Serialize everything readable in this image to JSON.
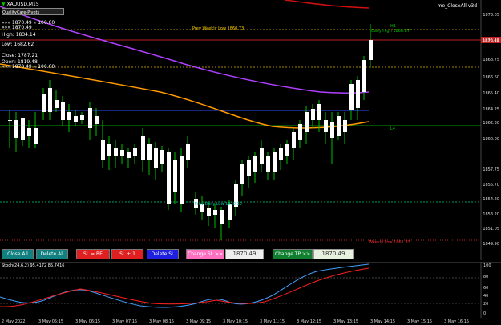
{
  "chart": {
    "symbol_line": "XAUUSD,M15",
    "indicator_name": "QualityCare-Pivots",
    "ea_name": "me_CloseAll v3d"
  },
  "info_panel": {
    "line1": "»»» 1870.49 « 100.00",
    "line2": "Open: 1819.48",
    "line3": "High: 1834.14",
    "line4": "Low: 1682.62",
    "line5": "Close: 1787.21",
    "line6": "»»» 1870.49",
    "line7": "»»» 1870.49 « 100.00"
  },
  "levels": {
    "prev_weekly_low": "Prev Weekly Low 1860.73",
    "daily_high": "Daily High 1868.87",
    "prev_daily_low": "Prev Daily Low 1850.10",
    "weekly_low": "Weekly Low 1861.33",
    "l4": "L4",
    "h1": "H1"
  },
  "price_axis": [
    "1873.05",
    "1870.49",
    "1868.75",
    "1866.60",
    "1865.40",
    "1864.25",
    "1862.30",
    "1860.00",
    "1857.75",
    "1855.70",
    "1854.20",
    "1853.20",
    "1851.05",
    "1849.90"
  ],
  "current_price": "1870.49",
  "stoch": {
    "label": "Stoch(24,6,2) 95.4172 85.7416",
    "axis": [
      "100",
      "80",
      "60",
      "40",
      "20",
      "0"
    ]
  },
  "time_axis": [
    "2 May 2022",
    "3 May 05:15",
    "3 May 06:15",
    "3 May 07:15",
    "3 May 08:15",
    "3 May 09:15",
    "3 May 10:15",
    "3 May 11:15",
    "3 May 12:15",
    "3 May 13:15",
    "3 May 14:15",
    "3 May 15:15",
    "3 May 16:15"
  ],
  "buttons": {
    "close_all": "Close All",
    "delete_all": "Delete All",
    "sl_be": "SL = BE",
    "sl_plus1": "SL + 1",
    "delete_sl": "Delete SL",
    "change_sl": "Change SL >>",
    "sl_value": "1870.49",
    "change_tp": "Change TP >>",
    "tp_value": "1870.49"
  },
  "colors": {
    "bull_candle": "#ffffff",
    "wick": "#00c000",
    "purple_ma": "#b040ff",
    "orange_ma": "#ff9900",
    "red_ma": "#ff2020",
    "blue_line": "#4060ff",
    "green_line": "#00b000",
    "stoch_main": "#40a0ff",
    "stoch_signal": "#ff2020"
  }
}
